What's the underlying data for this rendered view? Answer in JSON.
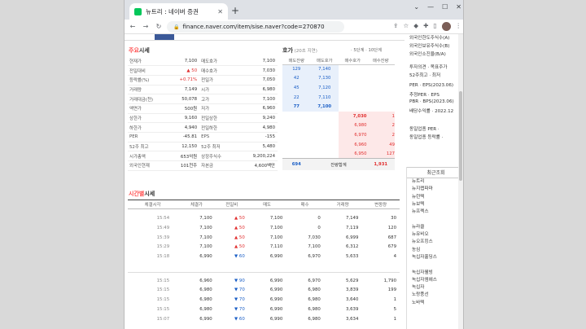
{
  "browser": {
    "tab_title": "뉴트리 : 네이버 증권",
    "url": "finance.naver.com/item/sise.naver?code=270870"
  },
  "quote": {
    "title_accent": "주요",
    "title_rest": "시세",
    "left": [
      [
        "현재가",
        "7,100"
      ],
      [
        "전일대비",
        "▲ 50"
      ],
      [
        "등락률(%)",
        "+0.71%"
      ],
      [
        "거래량",
        "7,149"
      ],
      [
        "거래대금(천)",
        "50,078"
      ],
      [
        "액면가",
        "500원"
      ],
      [
        "상한가",
        "9,160"
      ],
      [
        "하한가",
        "4,940"
      ],
      [
        "PER",
        "-45.81"
      ],
      [
        "52주 최고",
        "12,150"
      ],
      [
        "시가총액",
        "653억원"
      ],
      [
        "외국인현재",
        "101천주"
      ]
    ],
    "right": [
      [
        "매도호가",
        "7,100"
      ],
      [
        "매수호가",
        "7,030"
      ],
      [
        "전일가",
        "7,050"
      ],
      [
        "시가",
        "6,980"
      ],
      [
        "고가",
        "7,100"
      ],
      [
        "저가",
        "6,960"
      ],
      [
        "전일상한",
        "9,240"
      ],
      [
        "전일하한",
        "4,980"
      ],
      [
        "EPS",
        "-155"
      ],
      [
        "52주 최저",
        "5,480"
      ],
      [
        "상장주식수",
        "9,200,224"
      ],
      [
        "자본금",
        "4,600백만"
      ]
    ]
  },
  "hoga": {
    "title_accent": "호가",
    "title_rest": "(20초 지연)",
    "links": "· 5단계 · 10단계",
    "headers": [
      "매도잔량",
      "매도호가",
      "매수호가",
      "매수잔량"
    ],
    "asks": [
      [
        "129",
        "7,140"
      ],
      [
        "42",
        "7,130"
      ],
      [
        "45",
        "7,120"
      ],
      [
        "22",
        "7,110"
      ],
      [
        "77",
        "7,100"
      ]
    ],
    "bids": [
      [
        "7,030",
        "1"
      ],
      [
        "6,980",
        "2"
      ],
      [
        "6,970",
        "2"
      ],
      [
        "6,960",
        "49"
      ],
      [
        "6,950",
        "127"
      ]
    ],
    "total_left": "694",
    "total_label": "잔량합계",
    "total_right": "1,931"
  },
  "time": {
    "title_accent": "시간별",
    "title_rest": "시세",
    "headers": [
      "체결시각",
      "체결가",
      "전일비",
      "매도",
      "매수",
      "거래량",
      "변동량"
    ],
    "rows1": [
      [
        "15:54",
        "7,100",
        "▲ 50",
        "7,100",
        "0",
        "7,149",
        "30"
      ],
      [
        "15:49",
        "7,100",
        "▲ 50",
        "7,100",
        "0",
        "7,119",
        "120"
      ],
      [
        "15:39",
        "7,100",
        "▲ 50",
        "7,100",
        "7,030",
        "6,999",
        "687"
      ],
      [
        "15:29",
        "7,100",
        "▲ 50",
        "7,110",
        "7,100",
        "6,312",
        "679"
      ],
      [
        "15:18",
        "6,990",
        "▼ 60",
        "6,990",
        "6,970",
        "5,633",
        "4"
      ]
    ],
    "rows2": [
      [
        "15:15",
        "6,960",
        "▼ 90",
        "6,990",
        "6,970",
        "5,629",
        "1,790"
      ],
      [
        "15:15",
        "6,980",
        "▼ 70",
        "6,990",
        "6,980",
        "3,839",
        "199"
      ],
      [
        "15:15",
        "6,980",
        "▼ 70",
        "6,990",
        "6,980",
        "3,640",
        "1"
      ],
      [
        "15:15",
        "6,980",
        "▼ 70",
        "6,990",
        "6,980",
        "3,639",
        "5"
      ],
      [
        "15:07",
        "6,990",
        "▼ 60",
        "6,990",
        "6,980",
        "3,634",
        "1"
      ]
    ]
  },
  "side": {
    "holders": [
      "외국인한도주식수(A)",
      "외국인보유주식수(B)",
      "외국인소진율(B/A)"
    ],
    "opinion": [
      "투자의견 · 목표주가",
      "52주최고 · 최저"
    ],
    "metrics": [
      "PER · EPS(2023.06)",
      "추정PER · EPS",
      "PBR · BPS(2023.06)",
      "배당수익률 · 2022.12"
    ],
    "industry": [
      "동일업종 PER ·",
      "동일업종 등락률 ·"
    ],
    "recent_title": "최근조회",
    "recent": [
      "뉴트리",
      "뉴지랩파마",
      "뉴런텍",
      "뉴보텍",
      "뉴프렉스",
      "",
      "뉴라클",
      "뉴유비오",
      "뉴오프킹스",
      "농심",
      "녹십자홀딩스",
      "",
      "녹십자웰빙",
      "녹십자엠에스",
      "녹십자",
      "노랑풍선",
      "노바텍"
    ]
  },
  "colors": {
    "red": "#e12f2f",
    "blue": "#1a5ec6",
    "accent": "#ff4d4d"
  }
}
